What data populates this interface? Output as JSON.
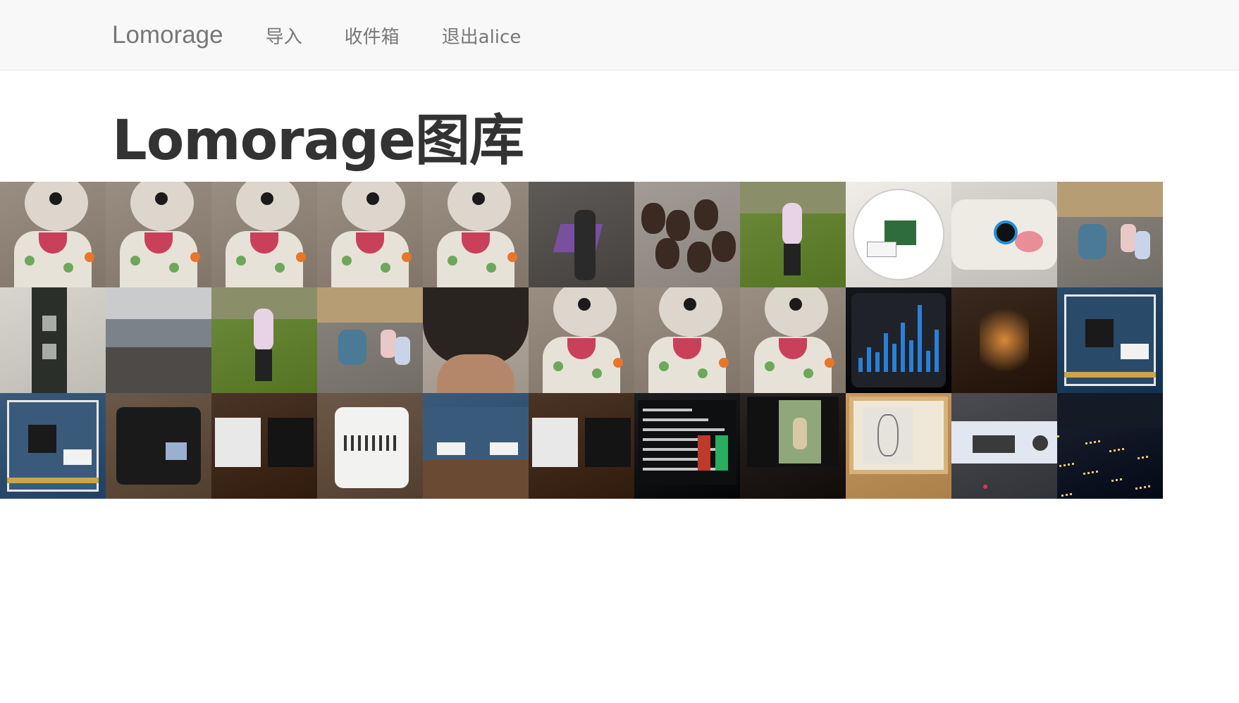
{
  "navbar": {
    "brand": "Lomorage",
    "links": [
      "导入",
      "收件箱",
      "退出alice"
    ]
  },
  "page": {
    "title": "Lomorage图库"
  },
  "gallery": {
    "photos": [
      {
        "subject": "plush-costume-child",
        "bg": "#9a8e82",
        "accent": "#6da85a"
      },
      {
        "subject": "plush-costume-child",
        "bg": "#9a8e82",
        "accent": "#6da85a"
      },
      {
        "subject": "plush-costume-child",
        "bg": "#9a8e82",
        "accent": "#6da85a"
      },
      {
        "subject": "plush-costume-child",
        "bg": "#9a8e82",
        "accent": "#6da85a"
      },
      {
        "subject": "plush-costume-child",
        "bg": "#9a8e82",
        "accent": "#6da85a"
      },
      {
        "subject": "kids-parachute-play",
        "bg": "#5d5a57",
        "accent": "#7b4fa0"
      },
      {
        "subject": "baked-food-tray",
        "bg": "#a39c96",
        "accent": "#3b2a22"
      },
      {
        "subject": "child-walking-grass",
        "bg": "#6e8d3c",
        "accent": "#e8d2e6"
      },
      {
        "subject": "circuit-in-bowl",
        "bg": "#f0ece7",
        "accent": "#2f6c3c"
      },
      {
        "subject": "white-device-button",
        "bg": "#d9d6d2",
        "accent": "#1d8fd6"
      },
      {
        "subject": "kids-classroom",
        "bg": "#8b867f",
        "accent": "#4a7a96"
      },
      {
        "subject": "board-ports-closeup",
        "bg": "#d8d4ce",
        "accent": "#2a2a2a"
      },
      {
        "subject": "beach-ocean",
        "bg": "#8d9094",
        "accent": "#c9cdd2"
      },
      {
        "subject": "child-walking-grass",
        "bg": "#6e8d3c",
        "accent": "#e8d2e6"
      },
      {
        "subject": "kids-classroom",
        "bg": "#8b867f",
        "accent": "#4a7a96"
      },
      {
        "subject": "curly-hair-closeup",
        "bg": "#b9aea3",
        "accent": "#2a2420"
      },
      {
        "subject": "plush-costume-child",
        "bg": "#9a8e82",
        "accent": "#6da85a"
      },
      {
        "subject": "plush-costume-child",
        "bg": "#9a8e82",
        "accent": "#6da85a"
      },
      {
        "subject": "plush-costume-child",
        "bg": "#9a8e82",
        "accent": "#6da85a"
      },
      {
        "subject": "updates-chart-screen",
        "bg": "#15171b",
        "accent": "#2a7fd8"
      },
      {
        "subject": "dark-mechanism",
        "bg": "#3a2a1f",
        "accent": "#d98a3a"
      },
      {
        "subject": "circuit-board-label",
        "bg": "#2a4a6a",
        "accent": "#c9a64a"
      },
      {
        "subject": "circuit-board",
        "bg": "#3a5a7c",
        "accent": "#c9a64a"
      },
      {
        "subject": "black-box-device",
        "bg": "#6b5848",
        "accent": "#1a1a1a"
      },
      {
        "subject": "white-black-cases",
        "bg": "#4a3426",
        "accent": "#e8e8e8"
      },
      {
        "subject": "white-case-hand",
        "bg": "#6b5848",
        "accent": "#f2f2f0"
      },
      {
        "subject": "circuit-boards-pair",
        "bg": "#3a5a7c",
        "accent": "#c9a64a"
      },
      {
        "subject": "white-black-cases",
        "bg": "#4a3426",
        "accent": "#e8e8e8"
      },
      {
        "subject": "terminal-screen",
        "bg": "#1c1e1f",
        "accent": "#c7c7c7"
      },
      {
        "subject": "monitor-child-photo",
        "bg": "#2a2422",
        "accent": "#d8c8a6"
      },
      {
        "subject": "eink-frame-drawing",
        "bg": "#c49a62",
        "accent": "#e6e3dc"
      },
      {
        "subject": "device-dashboard",
        "bg": "#4a4c52",
        "accent": "#e2e6f0"
      },
      {
        "subject": "city-night",
        "bg": "#1c2230",
        "accent": "#e8c46a"
      }
    ]
  }
}
